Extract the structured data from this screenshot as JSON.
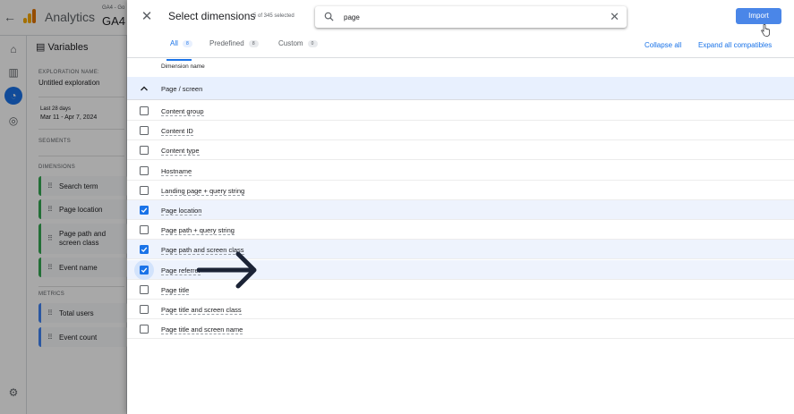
{
  "app": {
    "name": "Analytics",
    "property_small": "GA4 - Go",
    "property_big": "GA4",
    "variables_panel": {
      "title": "Variables",
      "exploration_name_label": "EXPLORATION NAME:",
      "exploration_name": "Untitled exploration",
      "date_range_label": "Last 28 days",
      "date_range": "Mar 11 - Apr 7, 2024",
      "segments_label": "SEGMENTS",
      "dimensions_label": "DIMENSIONS",
      "dimensions": [
        "Search term",
        "Page location",
        "Page path and screen class",
        "Event name"
      ],
      "metrics_label": "METRICS",
      "metrics": [
        "Total users",
        "Event count"
      ]
    }
  },
  "dialog": {
    "title": "Select dimensions",
    "selected_count": "5 of 345 selected",
    "search": {
      "value": "page",
      "placeholder": ""
    },
    "import_label": "Import",
    "tabs": [
      {
        "label": "All",
        "count": "8"
      },
      {
        "label": "Predefined",
        "count": "8"
      },
      {
        "label": "Custom",
        "count": "0"
      }
    ],
    "collapse_all_label": "Collapse all",
    "expand_all_label": "Expand all compatibles",
    "column_header": "Dimension name",
    "group_label": "Page / screen",
    "rows": [
      {
        "label": "Content group",
        "checked": false
      },
      {
        "label": "Content ID",
        "checked": false
      },
      {
        "label": "Content type",
        "checked": false
      },
      {
        "label": "Hostname",
        "checked": false
      },
      {
        "label": "Landing page + query string",
        "checked": false
      },
      {
        "label": "Page location",
        "checked": true
      },
      {
        "label": "Page path + query string",
        "checked": false
      },
      {
        "label": "Page path and screen class",
        "checked": true
      },
      {
        "label": "Page referrer",
        "checked": true
      },
      {
        "label": "Page title",
        "checked": false
      },
      {
        "label": "Page title and screen class",
        "checked": false
      },
      {
        "label": "Page title and screen name",
        "checked": false
      }
    ]
  },
  "colors": {
    "accent": "#1a73e8",
    "import_button": "#4a86e8",
    "selected_row": "#eef3fd",
    "group_row": "#e8f0fe",
    "annotation_arrow": "#1b2336"
  },
  "icons": {
    "close": "close-icon",
    "search": "search-icon",
    "clear": "clear-icon",
    "chevron": "chevron-up-icon",
    "cursor": "hand-pointer-icon",
    "annotation": "arrow-right-icon"
  }
}
